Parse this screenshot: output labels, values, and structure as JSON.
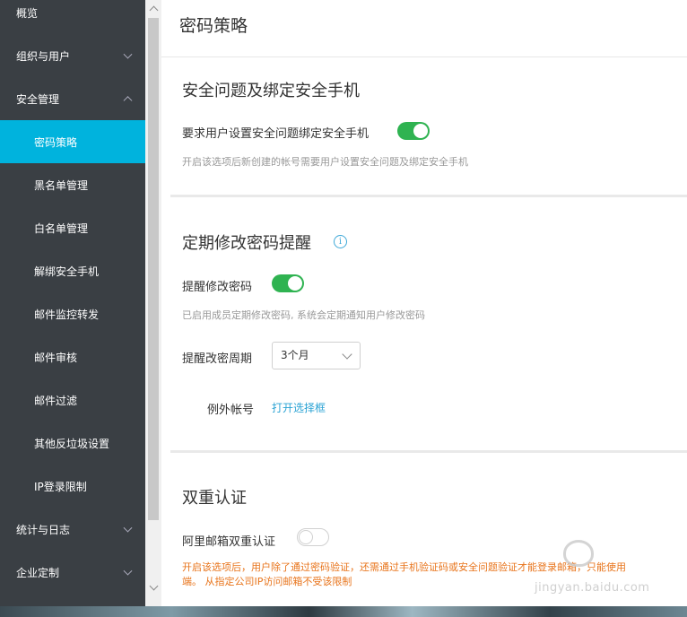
{
  "sidebar": {
    "items": [
      {
        "label": "概览",
        "chevron": ""
      },
      {
        "label": "组织与用户",
        "chevron": "down"
      },
      {
        "label": "安全管理",
        "chevron": "up"
      },
      {
        "label": "密码策略",
        "sub": true,
        "active": true
      },
      {
        "label": "黑名单管理",
        "sub": true
      },
      {
        "label": "白名单管理",
        "sub": true
      },
      {
        "label": "解绑安全手机",
        "sub": true
      },
      {
        "label": "邮件监控转发",
        "sub": true
      },
      {
        "label": "邮件审核",
        "sub": true
      },
      {
        "label": "邮件过滤",
        "sub": true
      },
      {
        "label": "其他反垃圾设置",
        "sub": true
      },
      {
        "label": "IP登录限制",
        "sub": true
      },
      {
        "label": "统计与日志",
        "chevron": "down"
      },
      {
        "label": "企业定制",
        "chevron": "down"
      }
    ]
  },
  "header": {
    "title": "密码策略"
  },
  "security_question": {
    "title": "安全问题及绑定安全手机",
    "toggle_label": "要求用户设置安全问题绑定安全手机",
    "toggle_state": "on",
    "hint": "开启该选项后新创建的帐号需要用户设置安全问题及绑定安全手机"
  },
  "password_reminder": {
    "title": "定期修改密码提醒",
    "info_icon": "i",
    "toggle_label": "提醒修改密码",
    "toggle_state": "on",
    "hint": "已启用成员定期修改密码, 系统会定期通知用户修改密码",
    "period_label": "提醒改密周期",
    "period_value": "3个月",
    "exception_label": "例外帐号",
    "exception_link": "打开选择框"
  },
  "two_factor": {
    "title": "双重认证",
    "toggle_label": "阿里邮箱双重认证",
    "toggle_state": "off",
    "warning_line1": "开启该选项后，用户除了通过密码验证，还需通过手机验证码或安全问题验证才能登录邮箱，只能使用",
    "warning_line2": "端。 从指定公司IP访问邮箱不受该限制"
  },
  "watermark": {
    "text": "jingyan.baidu.com"
  },
  "colors": {
    "sidebar_bg": "#3a3f44",
    "active_item": "#00b3dd",
    "toggle_on": "#2fb351",
    "link": "#2ba3d4",
    "warning": "#e8741b"
  }
}
